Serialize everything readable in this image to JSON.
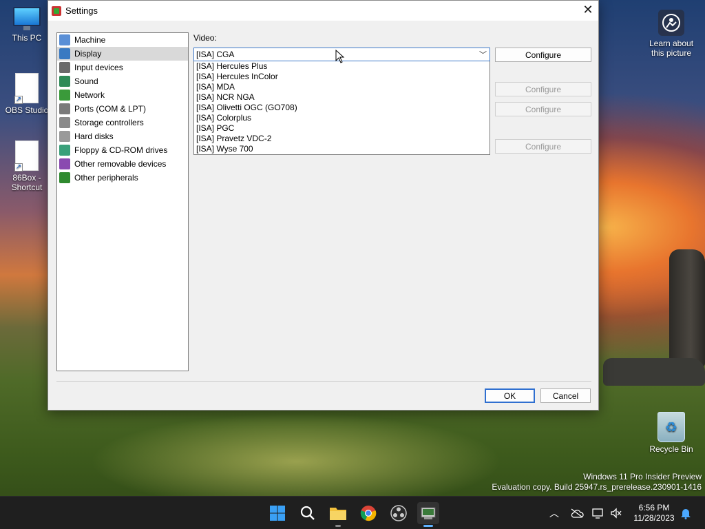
{
  "desktop": {
    "icons": [
      {
        "label": "This PC"
      },
      {
        "label": "OBS Studio"
      },
      {
        "label": "86Box - Shortcut"
      },
      {
        "label": "Learn about this picture"
      },
      {
        "label": "Recycle Bin"
      }
    ],
    "watermark": {
      "line1": "Windows 11 Pro Insider Preview",
      "line2": "Evaluation copy. Build 25947.rs_prerelease.230901-1416"
    }
  },
  "dialog": {
    "title": "Settings",
    "close_glyph": "✕",
    "categories": [
      {
        "label": "Machine",
        "icon_color": "#5a8fd6"
      },
      {
        "label": "Display",
        "icon_color": "#3a7ac2"
      },
      {
        "label": "Input devices",
        "icon_color": "#6a6a6a"
      },
      {
        "label": "Sound",
        "icon_color": "#2e8b57"
      },
      {
        "label": "Network",
        "icon_color": "#3a9a3a"
      },
      {
        "label": "Ports (COM & LPT)",
        "icon_color": "#7a7a7a"
      },
      {
        "label": "Storage controllers",
        "icon_color": "#8a8a8a"
      },
      {
        "label": "Hard disks",
        "icon_color": "#9a9a9a"
      },
      {
        "label": "Floppy & CD-ROM drives",
        "icon_color": "#3aa07a"
      },
      {
        "label": "Other removable devices",
        "icon_color": "#8a4ab0"
      },
      {
        "label": "Other peripherals",
        "icon_color": "#2f8a2f"
      }
    ],
    "selected_category": "Display",
    "video_label": "Video:",
    "video_value": "[ISA] CGA",
    "video_options": [
      "[ISA] Hercules Plus",
      "[ISA] Hercules InColor",
      "[ISA] MDA",
      "[ISA] NCR NGA",
      "[ISA] Olivetti OGC (GO708)",
      "[ISA] Colorplus",
      "[ISA] PGC",
      "[ISA] Pravetz VDC-2",
      "[ISA] Wyse 700"
    ],
    "configure_label": "Configure",
    "ok_label": "OK",
    "cancel_label": "Cancel"
  },
  "taskbar": {
    "apps": [
      "start",
      "search",
      "file-explorer",
      "chrome",
      "obs-studio",
      "86box"
    ],
    "active_app": "86box",
    "time": "6:56 PM",
    "date": "11/28/2023"
  }
}
